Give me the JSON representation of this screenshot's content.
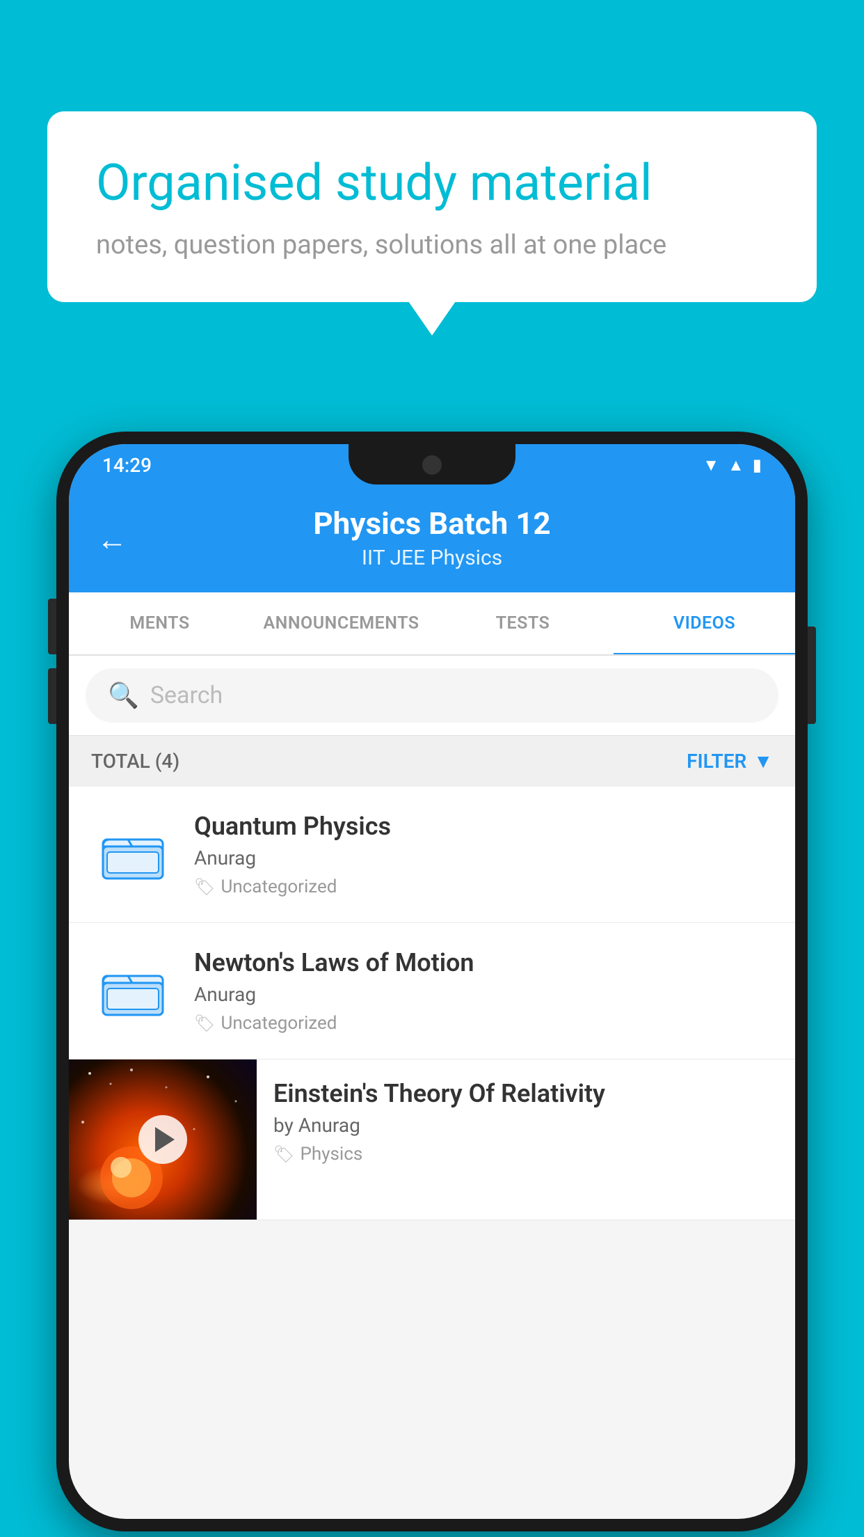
{
  "background_color": "#00BCD4",
  "bubble": {
    "title": "Organised study material",
    "subtitle": "notes, question papers, solutions all at one place"
  },
  "status_bar": {
    "time": "14:29",
    "icons": [
      "wifi",
      "signal",
      "battery"
    ]
  },
  "header": {
    "back_label": "←",
    "title": "Physics Batch 12",
    "subtitle": "IIT JEE    Physics"
  },
  "tabs": [
    {
      "label": "MENTS",
      "active": false
    },
    {
      "label": "ANNOUNCEMENTS",
      "active": false
    },
    {
      "label": "TESTS",
      "active": false
    },
    {
      "label": "VIDEOS",
      "active": true
    }
  ],
  "search": {
    "placeholder": "Search"
  },
  "filter": {
    "total_label": "TOTAL (4)",
    "filter_label": "FILTER"
  },
  "videos": [
    {
      "title": "Quantum Physics",
      "author": "Anurag",
      "tag": "Uncategorized",
      "type": "folder"
    },
    {
      "title": "Newton's Laws of Motion",
      "author": "Anurag",
      "tag": "Uncategorized",
      "type": "folder"
    },
    {
      "title": "Einstein's Theory Of Relativity",
      "author": "by Anurag",
      "tag": "Physics",
      "type": "video"
    }
  ]
}
